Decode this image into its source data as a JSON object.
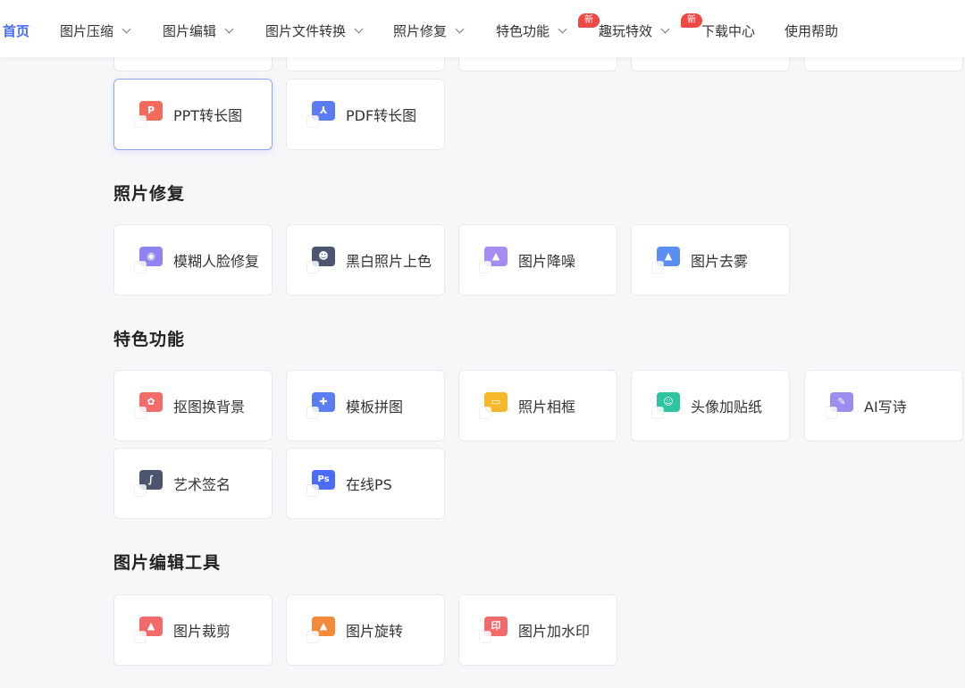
{
  "nav": {
    "items": [
      {
        "label": "首页",
        "active": true,
        "dropdown": false
      },
      {
        "label": "图片压缩",
        "dropdown": true
      },
      {
        "label": "图片编辑",
        "dropdown": true
      },
      {
        "label": "图片文件转换",
        "dropdown": true
      },
      {
        "label": "照片修复",
        "dropdown": true
      },
      {
        "label": "特色功能",
        "dropdown": true,
        "badge": "新"
      },
      {
        "label": "趣玩特效",
        "dropdown": true,
        "badge": "新"
      },
      {
        "label": "下载中心",
        "dropdown": false
      },
      {
        "label": "使用帮助",
        "dropdown": false
      }
    ]
  },
  "convert": {
    "cards": [
      {
        "label": "PPT转长图",
        "icon": "ppt-icon",
        "color": "#f26b5b"
      },
      {
        "label": "PDF转长图",
        "icon": "pdf-icon",
        "color": "#5b7cf2"
      }
    ]
  },
  "photo_repair": {
    "title": "照片修复",
    "cards": [
      {
        "label": "模糊人脸修复",
        "icon": "face-repair-icon",
        "color": "#8f84f0"
      },
      {
        "label": "黑白照片上色",
        "icon": "colorize-icon",
        "color": "#4b5570"
      },
      {
        "label": "图片降噪",
        "icon": "denoise-icon",
        "color": "#a48cf2"
      },
      {
        "label": "图片去雾",
        "icon": "dehaze-icon",
        "color": "#5b8ef2"
      }
    ]
  },
  "features": {
    "title": "特色功能",
    "cards": [
      {
        "label": "抠图换背景",
        "icon": "cutout-icon",
        "color": "#f26b6b"
      },
      {
        "label": "模板拼图",
        "icon": "collage-icon",
        "color": "#5b7cf2"
      },
      {
        "label": "照片相框",
        "icon": "frame-icon",
        "color": "#f5b82a"
      },
      {
        "label": "头像加贴纸",
        "icon": "sticker-icon",
        "color": "#2ec4a0"
      },
      {
        "label": "AI写诗",
        "icon": "poem-icon",
        "color": "#9a8ef0"
      },
      {
        "label": "艺术签名",
        "icon": "signature-icon",
        "color": "#4b5570"
      },
      {
        "label": "在线PS",
        "icon": "ps-icon",
        "color": "#4a6cf7"
      }
    ]
  },
  "edit_tools": {
    "title": "图片编辑工具",
    "cards": [
      {
        "label": "图片裁剪",
        "icon": "crop-icon",
        "color": "#f26b6b"
      },
      {
        "label": "图片旋转",
        "icon": "rotate-icon",
        "color": "#f5893a"
      },
      {
        "label": "图片加水印",
        "icon": "watermark-icon",
        "color": "#f26b6b"
      }
    ]
  }
}
